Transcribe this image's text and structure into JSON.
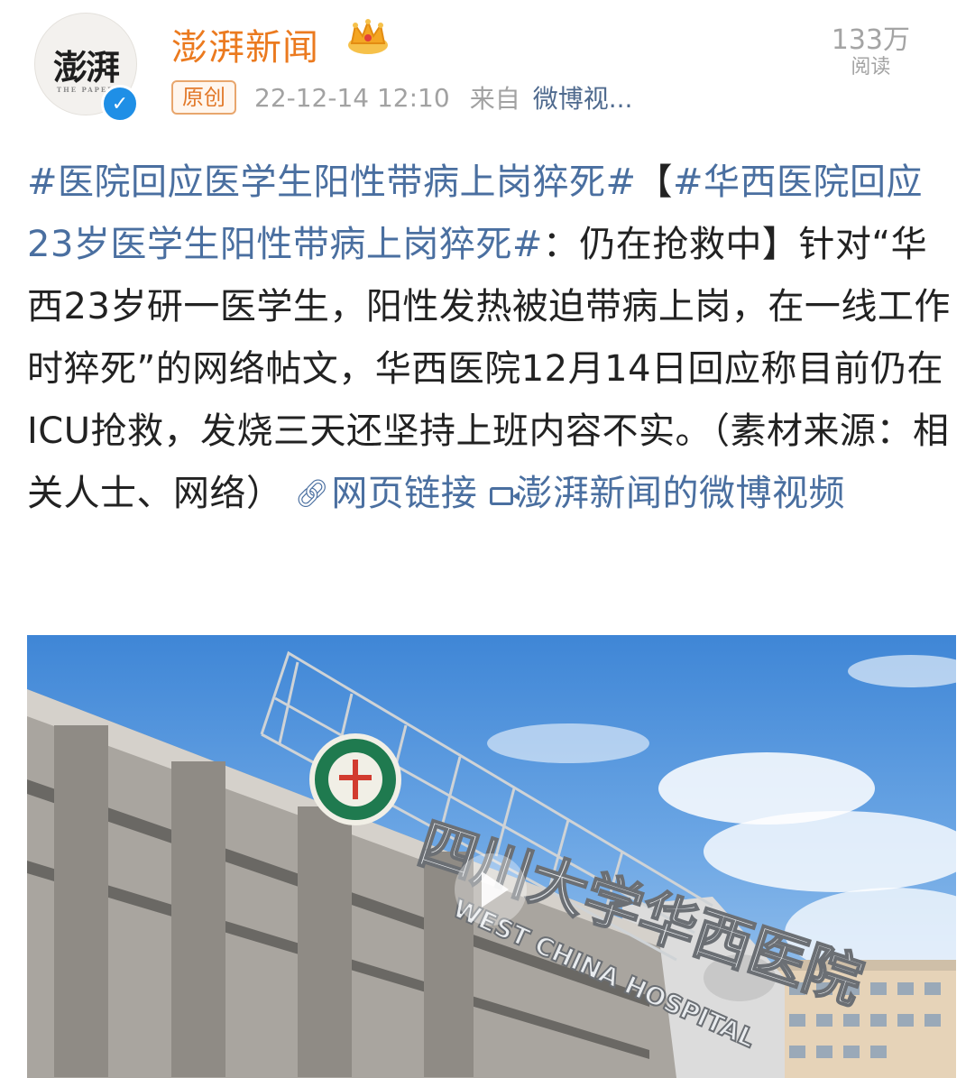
{
  "header": {
    "avatar_text": "澎湃",
    "avatar_sub": "THE PAPER",
    "account_name": "澎湃新闻",
    "badge": "原创",
    "timestamp": "22-12-14 12:10",
    "from_label": "来自",
    "source": "微博视...",
    "read_count": "133万",
    "read_label": "阅读"
  },
  "post": {
    "topic1": "#医院回应医学生阳性带病上岗猝死#",
    "bracket_open": "【",
    "topic2": "#华西医院回应23岁医学生阳性带病上岗猝死#",
    "title_rest": "：仍在抢救中",
    "bracket_close": "】",
    "body": "针对“华西23岁研一医学生，阳性发热被迫带病上岗，在一线工作时猝死”的网络帖文，华西医院12月14日回应称目前仍在ICU抢救，发烧三天还坚持上班内容不实。（素材来源：相关人士、网络）",
    "link_label": "网页链接",
    "video_label": "澎湃新闻的微博视频"
  },
  "video": {
    "sign_text": "四川大学华西医院",
    "sign_text_en": "WEST CHINA HOSPITAL"
  },
  "colors": {
    "account_name": "#eb7a1f",
    "link": "#4a6fa0",
    "verified": "#1f8fe6",
    "meta": "#a2a2a2"
  },
  "icons": [
    "crown-icon",
    "verified-icon",
    "link-icon",
    "video-icon",
    "play-icon"
  ]
}
